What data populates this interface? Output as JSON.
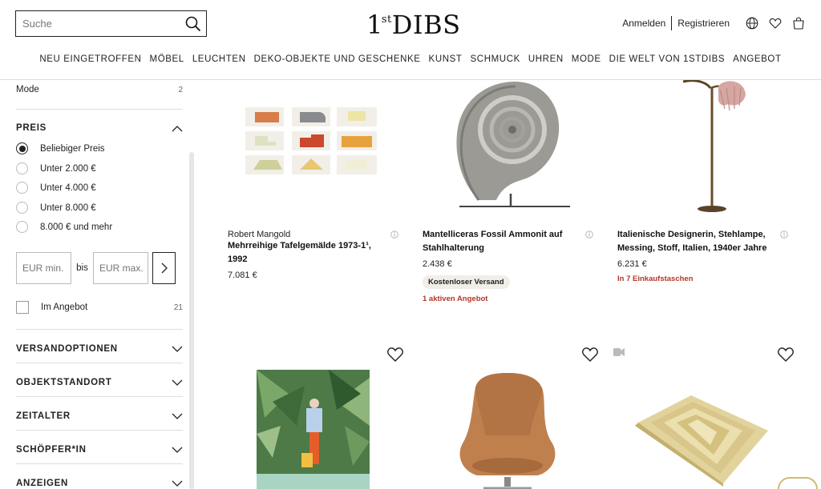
{
  "search": {
    "placeholder": "Suche"
  },
  "logo": {
    "main": "1",
    "sup": "st",
    "rest": "DIBS"
  },
  "account": {
    "login": "Anmelden",
    "register": "Registrieren"
  },
  "nav": [
    "NEU EINGETROFFEN",
    "MÖBEL",
    "LEUCHTEN",
    "DEKO-OBJEKTE UND GESCHENKE",
    "KUNST",
    "SCHMUCK",
    "UHREN",
    "MODE",
    "DIE WELT VON 1STDIBS",
    "ANGEBOT"
  ],
  "sidebar": {
    "mode": {
      "label": "Mode",
      "count": "2"
    },
    "price_section": "PREIS",
    "price_options": [
      "Beliebiger Preis",
      "Unter 2.000 €",
      "Unter 4.000 €",
      "Unter 8.000 €",
      "8.000 € und mehr"
    ],
    "price_min_placeholder": "EUR min.",
    "price_between": "bis",
    "price_max_placeholder": "EUR max.",
    "sale": {
      "label": "Im Angebot",
      "count": "21"
    },
    "sections": [
      "VERSANDOPTIONEN",
      "OBJEKTSTANDORT",
      "ZEITALTER",
      "SCHÖPFER*IN",
      "ANZEIGEN"
    ]
  },
  "products": [
    {
      "maker": "Robert Mangold",
      "title": "Mehrreihige Tafelgemälde 1973-1¹, 1992",
      "price": "7.081 €"
    },
    {
      "title_line1": "Mantelliceras Fossil Ammonit auf",
      "title_line2": "Stahlhalterung",
      "price": "2.438 €",
      "badge": "Kostenloser Versand",
      "offer": "1 aktiven Angebot"
    },
    {
      "title_line1": "Italienische Designerin, Stehlampe,",
      "title_line2": "Messing, Stoff, Italien, 1940er Jahre",
      "price": "6.231 €",
      "carts": "In 7 Einkaufstaschen"
    }
  ],
  "colors": {
    "accent_red": "#b2362a",
    "badge_bg": "#f1ede7",
    "chair_leather": "#c0804e"
  }
}
